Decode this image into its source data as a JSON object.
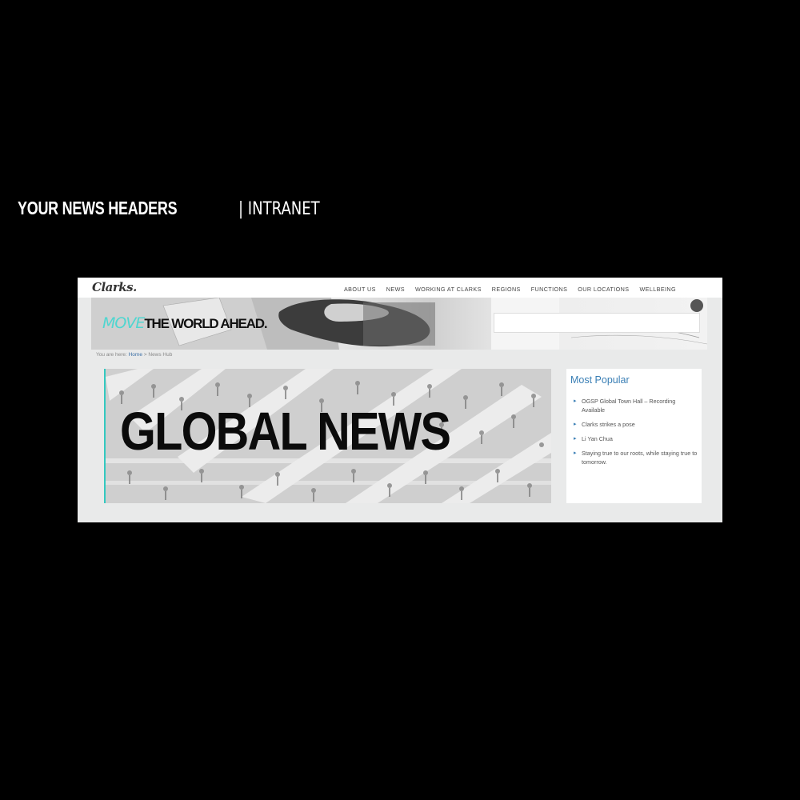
{
  "page_heading": {
    "bold": "YOUR NEWS HEADERS",
    "separator": "| INTRANET"
  },
  "intranet": {
    "logo": "Clarks.",
    "nav": [
      "ABOUT US",
      "NEWS",
      "WORKING AT CLARKS",
      "REGIONS",
      "FUNCTIONS",
      "OUR LOCATIONS",
      "WELLBEING"
    ],
    "banner": {
      "move": "MOVE",
      "rest": "THE WORLD AHEAD."
    },
    "breadcrumb": {
      "prefix": "You are here:",
      "home": "Home",
      "sep": ">",
      "current": "News Hub"
    },
    "hero_title": "GLOBAL NEWS",
    "most_popular": {
      "title": "Most Popular",
      "items": [
        "OGSP Global Town Hall – Recording Available",
        "Clarks strikes a pose",
        "Li Yan Chua",
        "Staying true to our roots, while staying true to tomorrow."
      ]
    }
  },
  "colors": {
    "accent": "#33c9c0",
    "link": "#3a7fb5",
    "move_text": "#4fd6d0"
  },
  "icons": [
    "bullet-arrow-icon"
  ]
}
